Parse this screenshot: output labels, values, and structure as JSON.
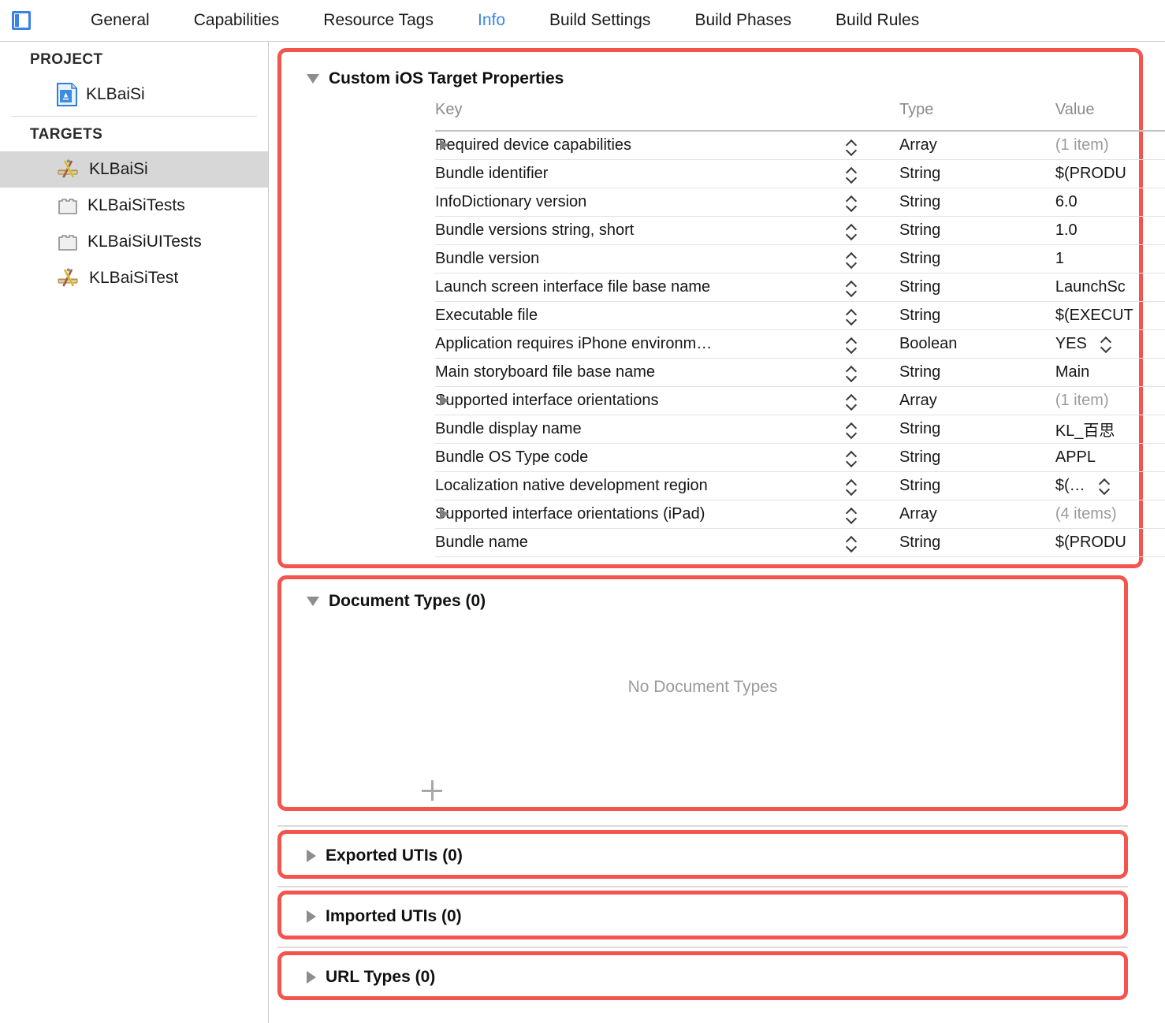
{
  "window": {
    "sidebar_toggle_icon": "sidebar-toggle-icon"
  },
  "tabs": [
    {
      "label": "General",
      "active": false
    },
    {
      "label": "Capabilities",
      "active": false
    },
    {
      "label": "Resource Tags",
      "active": false
    },
    {
      "label": "Info",
      "active": true
    },
    {
      "label": "Build Settings",
      "active": false
    },
    {
      "label": "Build Phases",
      "active": false
    },
    {
      "label": "Build Rules",
      "active": false
    }
  ],
  "sidebar": {
    "project_header": "PROJECT",
    "targets_header": "TARGETS",
    "project_items": [
      {
        "label": "KLBaiSi",
        "icon": "xcode-project-icon"
      }
    ],
    "target_items": [
      {
        "label": "KLBaiSi",
        "icon": "xcode-target-app-icon",
        "selected": true
      },
      {
        "label": "KLBaiSiTests",
        "icon": "xcode-target-bundle-icon",
        "selected": false
      },
      {
        "label": "KLBaiSiUITests",
        "icon": "xcode-target-bundle-icon",
        "selected": false
      },
      {
        "label": "KLBaiSiTest",
        "icon": "xcode-target-app-icon",
        "selected": false
      }
    ]
  },
  "sections": {
    "custom_properties": {
      "title": "Custom iOS Target Properties",
      "expanded": true,
      "columns": {
        "key": "Key",
        "type": "Type",
        "value": "Value"
      },
      "rows": [
        {
          "key": "Required device capabilities",
          "type": "Array",
          "value": "(1 item)",
          "expandable": true,
          "muted_value": true,
          "value_stepper": false
        },
        {
          "key": "Bundle identifier",
          "type": "String",
          "value": "$(PRODU",
          "expandable": false,
          "muted_value": false,
          "value_stepper": false
        },
        {
          "key": "InfoDictionary version",
          "type": "String",
          "value": "6.0",
          "expandable": false,
          "muted_value": false,
          "value_stepper": false
        },
        {
          "key": "Bundle versions string, short",
          "type": "String",
          "value": "1.0",
          "expandable": false,
          "muted_value": false,
          "value_stepper": false
        },
        {
          "key": "Bundle version",
          "type": "String",
          "value": "1",
          "expandable": false,
          "muted_value": false,
          "value_stepper": false
        },
        {
          "key": "Launch screen interface file base name",
          "type": "String",
          "value": "LaunchSc",
          "expandable": false,
          "muted_value": false,
          "value_stepper": false
        },
        {
          "key": "Executable file",
          "type": "String",
          "value": "$(EXECUT",
          "expandable": false,
          "muted_value": false,
          "value_stepper": false
        },
        {
          "key": "Application requires iPhone environm…",
          "type": "Boolean",
          "value": "YES",
          "expandable": false,
          "muted_value": false,
          "value_stepper": true
        },
        {
          "key": "Main storyboard file base name",
          "type": "String",
          "value": "Main",
          "expandable": false,
          "muted_value": false,
          "value_stepper": false
        },
        {
          "key": "Supported interface orientations",
          "type": "Array",
          "value": "(1 item)",
          "expandable": true,
          "muted_value": true,
          "value_stepper": false
        },
        {
          "key": "Bundle display name",
          "type": "String",
          "value": "KL_百思",
          "expandable": false,
          "muted_value": false,
          "value_stepper": false
        },
        {
          "key": "Bundle OS Type code",
          "type": "String",
          "value": "APPL",
          "expandable": false,
          "muted_value": false,
          "value_stepper": false
        },
        {
          "key": "Localization native development region",
          "type": "String",
          "value": "$(…",
          "expandable": false,
          "muted_value": false,
          "value_stepper": true
        },
        {
          "key": "Supported interface orientations (iPad)",
          "type": "Array",
          "value": "(4 items)",
          "expandable": true,
          "muted_value": true,
          "value_stepper": false
        },
        {
          "key": "Bundle name",
          "type": "String",
          "value": "$(PRODU",
          "expandable": false,
          "muted_value": false,
          "value_stepper": false
        }
      ]
    },
    "document_types": {
      "title": "Document Types (0)",
      "expanded": true,
      "empty_message": "No Document Types",
      "add_button": "add-document-type-button"
    },
    "exported_utis": {
      "title": "Exported UTIs (0)",
      "expanded": false
    },
    "imported_utis": {
      "title": "Imported UTIs (0)",
      "expanded": false
    },
    "url_types": {
      "title": "URL Types (0)",
      "expanded": false
    }
  },
  "colors": {
    "accent_blue": "#3d86e8",
    "highlight_red": "#f4544e",
    "selected_row": "#d7d7d7",
    "muted_text": "#8a8a8a"
  }
}
